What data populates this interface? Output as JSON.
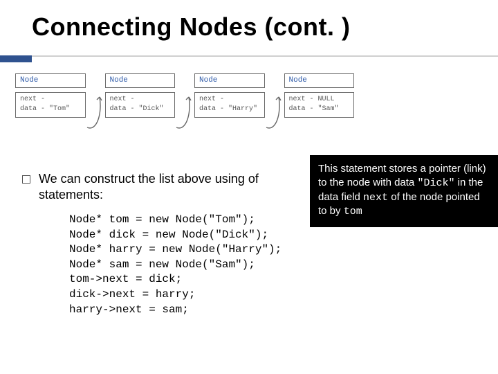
{
  "title": "Connecting Nodes (cont. )",
  "node_label": "Node",
  "nodes": [
    {
      "next": "",
      "data": "\"Tom\"",
      "has_arrow": true
    },
    {
      "next": "",
      "data": "\"Dick\"",
      "has_arrow": true
    },
    {
      "next": "",
      "data": "\"Harry\"",
      "has_arrow": true
    },
    {
      "next": "NULL",
      "data": "\"Sam\"",
      "has_arrow": false
    }
  ],
  "bullet": "We can construct the list above using of statements:",
  "code": [
    "Node* tom = new Node(\"Tom\");",
    "Node* dick = new Node(\"Dick\");",
    "Node* harry = new Node(\"Harry\");",
    "Node* sam = new Node(\"Sam\");",
    "tom->next = dick;",
    "dick->next = harry;",
    "harry->next = sam;"
  ],
  "tooltip": {
    "t1": "This statement stores a pointer (link) to the node with data ",
    "code1": "\"Dick\"",
    "t2": " in the data field ",
    "code2": "next",
    "t3": " of the node pointed to by ",
    "code3": "tom"
  }
}
